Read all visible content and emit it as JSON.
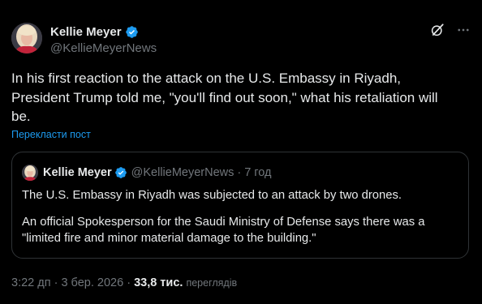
{
  "author": {
    "name": "Kellie Meyer",
    "handle": "@KellieMeyerNews",
    "verified": true
  },
  "tweet": {
    "text": "In his first reaction to the attack on the U.S. Embassy in Riyadh,\nPresident Trump told me, \"you'll find out soon,\" what his retaliation will\nbe.",
    "translate_label": "Перекласти пост"
  },
  "quote": {
    "name": "Kellie Meyer",
    "handle": "@KellieMeyerNews",
    "separator": "·",
    "time": "7 год",
    "paragraph1": "The U.S. Embassy in Riyadh was subjected to an attack by two drones.",
    "paragraph2": "An official Spokesperson for the Saudi Ministry of Defense says there was a \"limited fire and minor material damage to the building.\""
  },
  "meta": {
    "time": "3:22 дп",
    "separator": "·",
    "date": "3 бер. 2026",
    "separator2": "·",
    "views_count": "33,8 тис.",
    "views_label": "переглядів"
  },
  "icons": {
    "verified": "verified-badge-icon",
    "grok": "grok-icon",
    "more": "more-icon"
  },
  "colors": {
    "background": "#000000",
    "text": "#e7e9ea",
    "secondary": "#71767b",
    "accent": "#1d9bf0",
    "border": "#2f3336"
  }
}
